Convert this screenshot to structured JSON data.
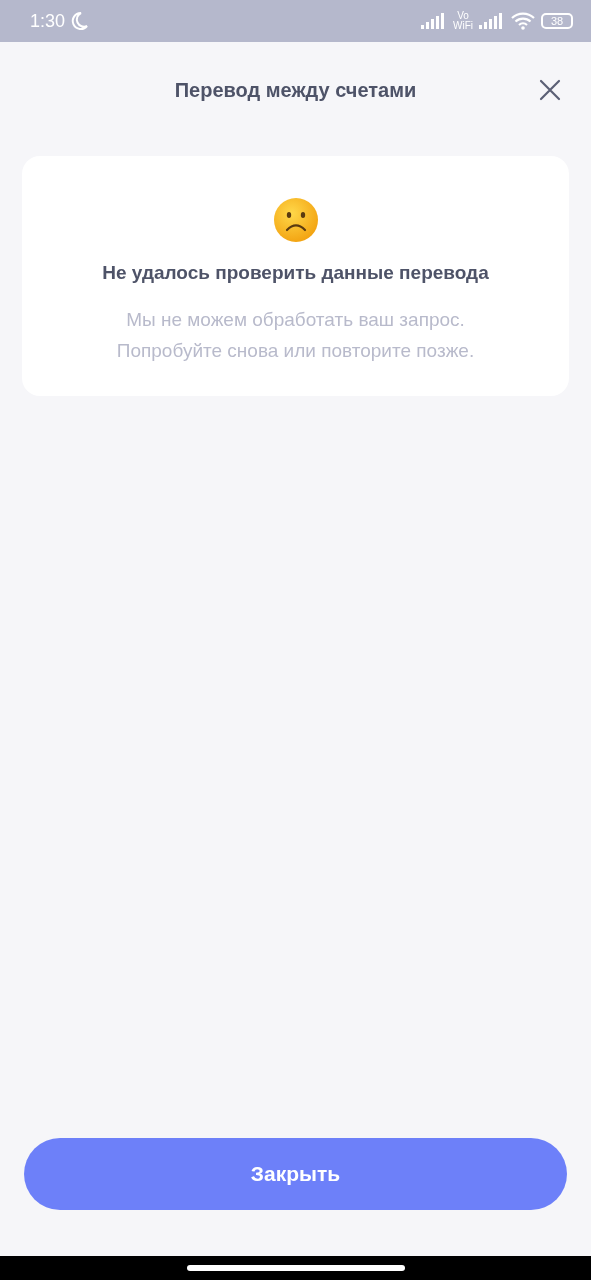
{
  "status_bar": {
    "time": "1:30",
    "vowifi_top": "Vo",
    "vowifi_bottom": "WiFi",
    "battery": "38"
  },
  "header": {
    "title": "Перевод между счетами"
  },
  "card": {
    "title": "Не удалось проверить данные перевода",
    "message": [
      "Мы не можем обработать ваш запрос.",
      "Попробуйте снова или повторите позже."
    ]
  },
  "buttons": [
    "Закрыть"
  ]
}
